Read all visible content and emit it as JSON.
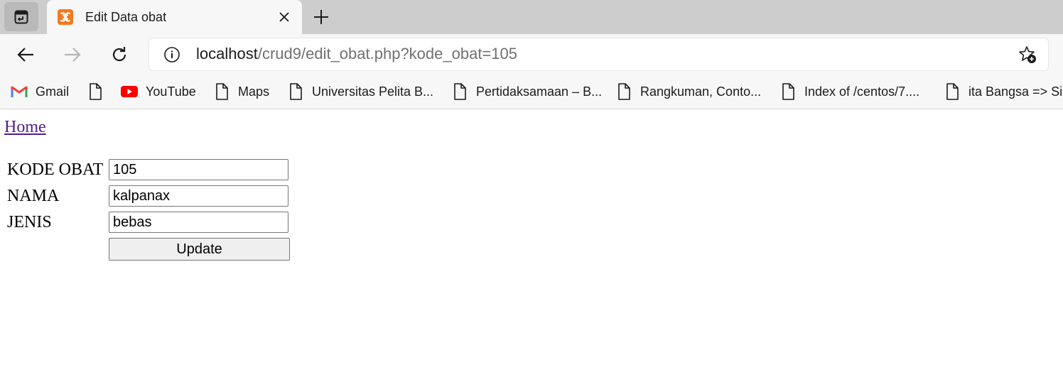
{
  "browser": {
    "tab": {
      "title": "Edit Data obat"
    },
    "address": {
      "host": "localhost",
      "path": "/crud9/edit_obat.php?kode_obat=105"
    },
    "bookmarks": [
      {
        "label": "Gmail",
        "icon": "gmail-icon"
      },
      {
        "label": "",
        "icon": "document-icon"
      },
      {
        "label": "YouTube",
        "icon": "youtube-icon"
      },
      {
        "label": "Maps",
        "icon": "document-icon"
      },
      {
        "label": "Universitas Pelita B...",
        "icon": "document-icon"
      },
      {
        "label": "Pertidaksamaan – B...",
        "icon": "document-icon"
      },
      {
        "label": "Rangkuman, Conto...",
        "icon": "document-icon"
      },
      {
        "label": "Index of /centos/7....",
        "icon": "document-icon"
      },
      {
        "label": "ita Bangsa => Sil",
        "icon": "document-icon"
      }
    ]
  },
  "page": {
    "home_link": "Home",
    "form": {
      "fields": [
        {
          "label": "KODE OBAT",
          "value": "105"
        },
        {
          "label": "NAMA",
          "value": "kalpanax"
        },
        {
          "label": "JENIS",
          "value": "bebas"
        }
      ],
      "submit_label": "Update"
    }
  },
  "colors": {
    "link_visited": "#551a8b",
    "tab_strip": "#cdcdcd",
    "toolbar": "#f7f7f7",
    "favicon_orange": "#f4791f",
    "youtube_red": "#ff0000"
  }
}
